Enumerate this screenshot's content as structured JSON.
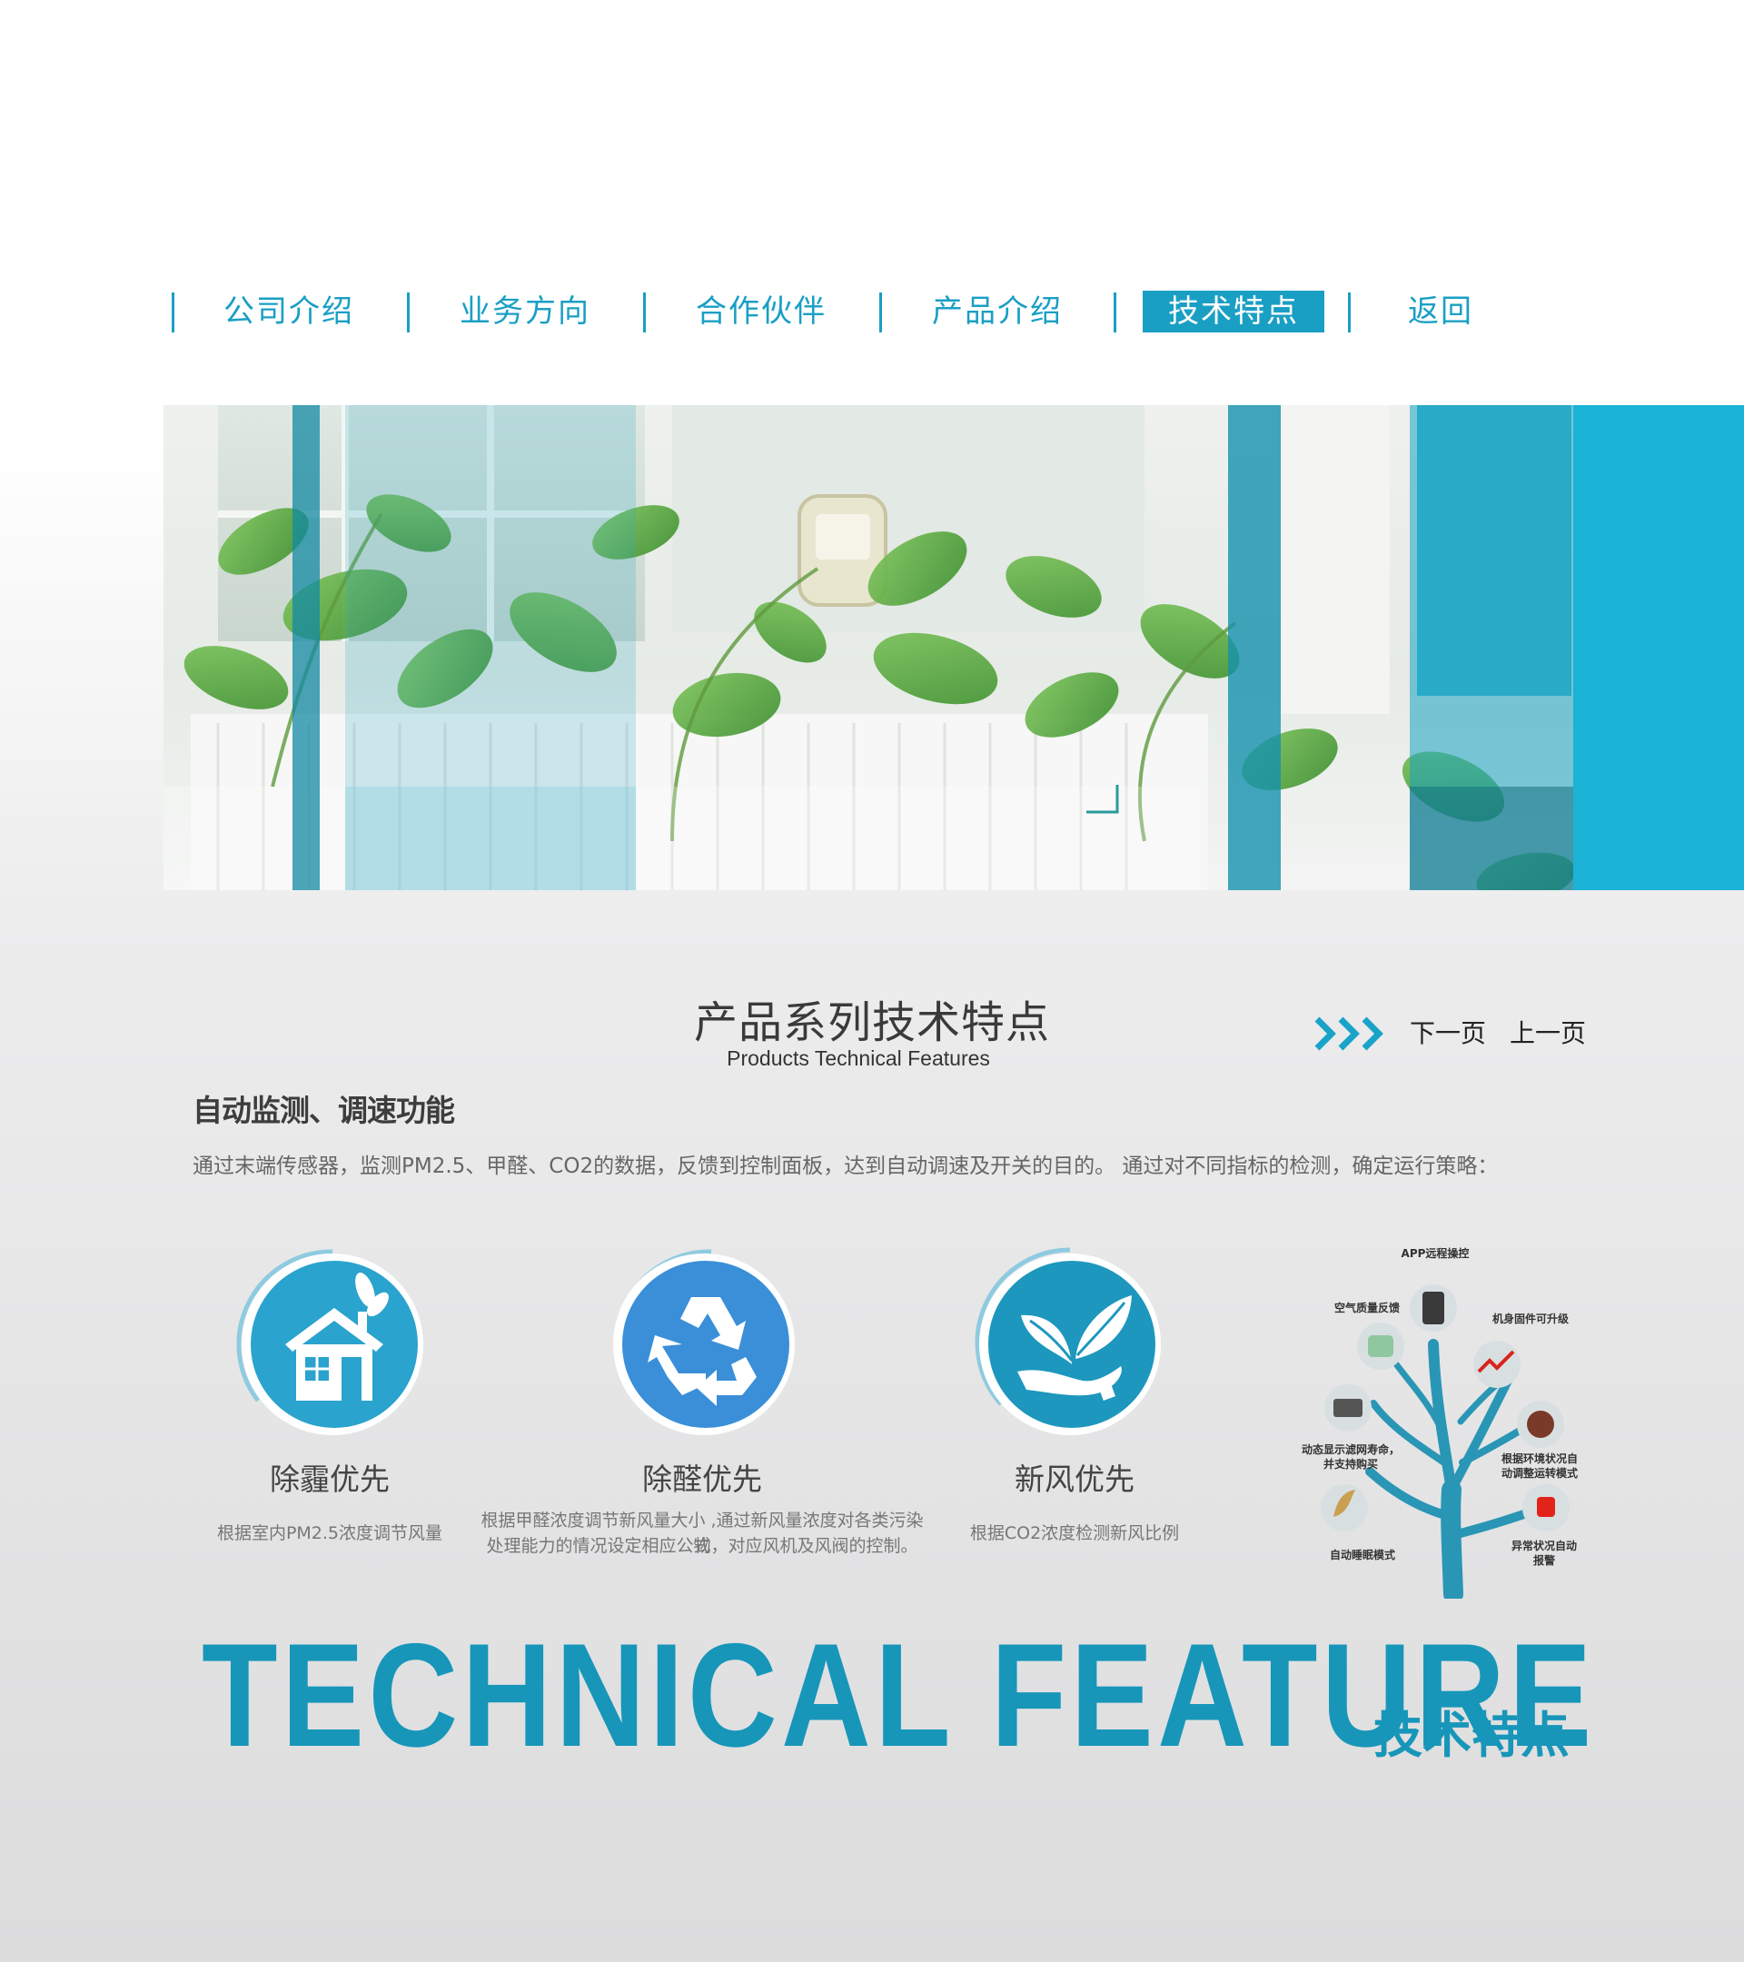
{
  "nav": {
    "items": [
      {
        "label": "公司介绍"
      },
      {
        "label": "业务方向"
      },
      {
        "label": "合作伙伴"
      },
      {
        "label": "产品介绍"
      },
      {
        "label": "技术特点",
        "active": true
      },
      {
        "label": "返回"
      }
    ],
    "accent_color": "#1a9fc4"
  },
  "section": {
    "title": "产品系列技术特点",
    "subtitle": "Products Technical Features",
    "next_label": "下一页",
    "prev_label": "上一页"
  },
  "feature": {
    "heading": "自动监测、调速功能",
    "description": "通过末端传感器，监测PM2.5、甲醛、CO2的数据，反馈到控制面板，达到自动调速及开关的目的。  通过对不同指标的检测，确定运行策略："
  },
  "cards": [
    {
      "icon": "house-icon",
      "title": "除霾优先",
      "desc_lines": [
        "根据室内PM2.5浓度调节风量"
      ]
    },
    {
      "icon": "recycle-icon",
      "title": "除醛优先",
      "desc_lines": [
        "根据甲醛浓度调节新风量大小 ,通过新风量浓度对各类污染物",
        "处理能力的情况设定相应公式，对应风机及风阀的控制。"
      ]
    },
    {
      "icon": "leaf-hand-icon",
      "title": "新风优先",
      "desc_lines": [
        "根据CO2浓度检测新风比例"
      ]
    }
  ],
  "tree": {
    "labels": {
      "app": "APP远程操控",
      "air": "空气质量反馈",
      "upgrade": "机身固件可升级",
      "filter_1": "动态显示滤网寿命，",
      "filter_2": "并支持购买",
      "env_1": "根据环境状况自",
      "env_2": "动调整运转模式",
      "sleep": "自动睡眠模式",
      "alarm_1": "异常状况自动",
      "alarm_2": "报警"
    }
  },
  "footer": {
    "big_title": "TECHNICAL FEATURE",
    "big_title_cn": "技术特点",
    "color": "#1796b9"
  }
}
